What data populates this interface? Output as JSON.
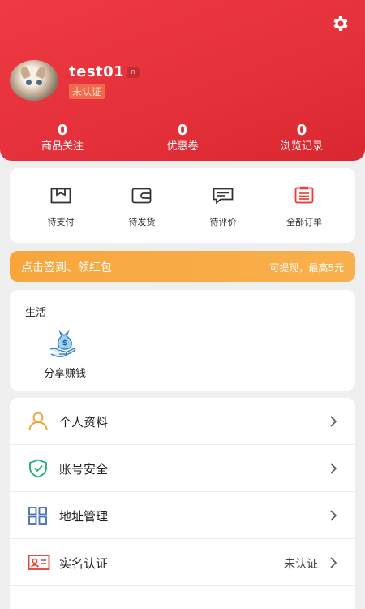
{
  "profile": {
    "username": "test01",
    "level": "n",
    "auth_status": "未认证"
  },
  "stats": [
    {
      "value": "0",
      "label": "商品关注"
    },
    {
      "value": "0",
      "label": "优惠卷"
    },
    {
      "value": "0",
      "label": "浏览记录"
    }
  ],
  "orders": [
    {
      "label": "待支付",
      "icon": "box-icon"
    },
    {
      "label": "待发货",
      "icon": "wallet-icon"
    },
    {
      "label": "待评价",
      "icon": "comment-icon"
    },
    {
      "label": "全部订单",
      "icon": "clipboard-icon"
    }
  ],
  "banner": {
    "left": "点击签到、领红包",
    "right": "可提现，最高5元"
  },
  "life": {
    "title": "生活",
    "items": [
      {
        "label": "分享赚钱",
        "icon": "money-bag-hand-icon"
      }
    ]
  },
  "menu": [
    {
      "label": "个人资料",
      "icon": "user-icon",
      "value": ""
    },
    {
      "label": "账号安全",
      "icon": "shield-check-icon",
      "value": ""
    },
    {
      "label": "地址管理",
      "icon": "grid-icon",
      "value": ""
    },
    {
      "label": "实名认证",
      "icon": "id-card-icon",
      "value": "未认证"
    }
  ],
  "colors": {
    "header_red": "#e4303a",
    "banner_orange": "#f9aa44",
    "accent_green": "#27b07a",
    "accent_blue": "#4c74b6",
    "accent_orange": "#f0a43a"
  }
}
